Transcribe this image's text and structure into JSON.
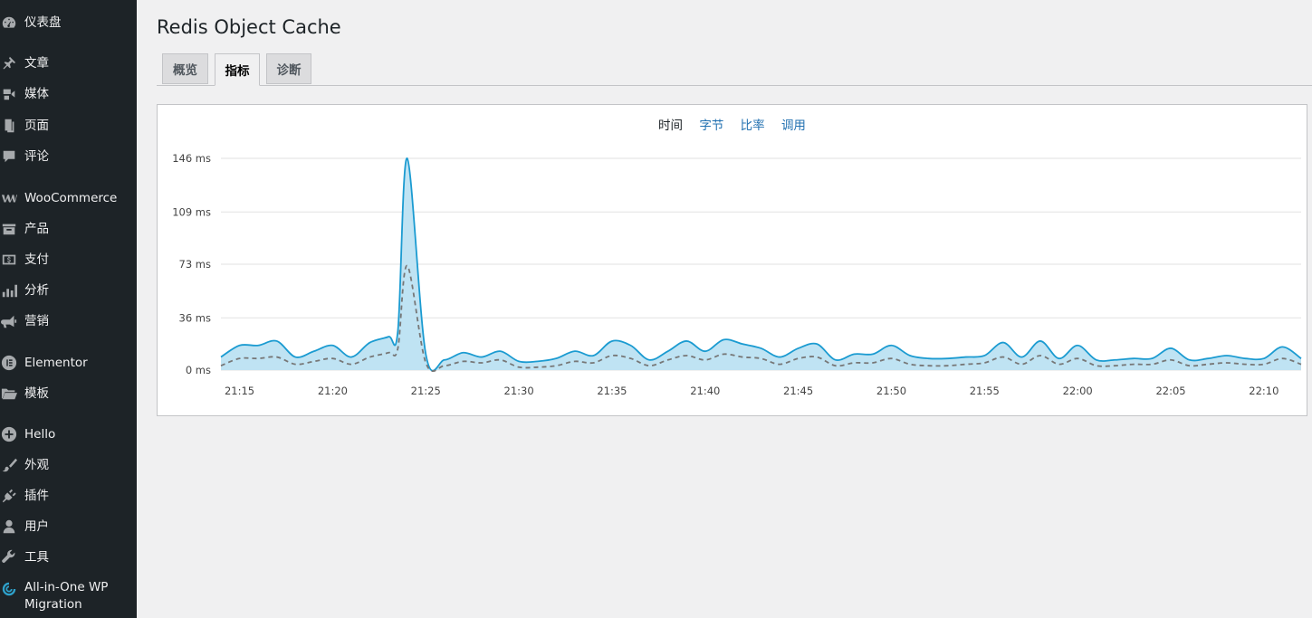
{
  "sidebar": {
    "items": [
      {
        "label": "仪表盘",
        "icon": "dashboard-icon"
      },
      {
        "label": "文章",
        "icon": "pushpin-icon"
      },
      {
        "label": "媒体",
        "icon": "media-icon"
      },
      {
        "label": "页面",
        "icon": "pages-icon"
      },
      {
        "label": "评论",
        "icon": "comment-icon"
      },
      {
        "label": "WooCommerce",
        "icon": "woocommerce-icon"
      },
      {
        "label": "产品",
        "icon": "archive-icon"
      },
      {
        "label": "支付",
        "icon": "money-icon"
      },
      {
        "label": "分析",
        "icon": "bar-chart-icon"
      },
      {
        "label": "营销",
        "icon": "megaphone-icon"
      },
      {
        "label": "Elementor",
        "icon": "elementor-icon"
      },
      {
        "label": "模板",
        "icon": "folder-open-icon"
      },
      {
        "label": "Hello",
        "icon": "plus-circle-icon"
      },
      {
        "label": "外观",
        "icon": "brush-icon"
      },
      {
        "label": "插件",
        "icon": "plug-icon"
      },
      {
        "label": "用户",
        "icon": "user-icon"
      },
      {
        "label": "工具",
        "icon": "wrench-icon"
      },
      {
        "label": "All-in-One WP Migration",
        "icon": "migration-icon"
      }
    ]
  },
  "page": {
    "title": "Redis Object Cache"
  },
  "tabs": [
    {
      "label": "概览"
    },
    {
      "label": "指标"
    },
    {
      "label": "诊断"
    }
  ],
  "chart_switch": [
    {
      "label": "时间"
    },
    {
      "label": "字节"
    },
    {
      "label": "比率"
    },
    {
      "label": "调用"
    }
  ],
  "colors": {
    "sidebar_bg": "#1d2327",
    "accent": "#2271b1",
    "series_line": "#1b9bd1",
    "series_fill": "#bfe3f3",
    "dashed_line": "#777777"
  },
  "chart_data": {
    "type": "area",
    "ylabel": "",
    "xlabel": "",
    "y_unit": "ms",
    "yticks": [
      "0 ms",
      "36 ms",
      "73 ms",
      "109 ms",
      "146 ms"
    ],
    "ytick_values": [
      0,
      36,
      73,
      109,
      146
    ],
    "ylim": [
      0,
      146
    ],
    "xticks": [
      "21:15",
      "21:20",
      "21:25",
      "21:30",
      "21:35",
      "21:40",
      "21:45",
      "21:50",
      "21:55",
      "22:00",
      "22:05",
      "22:10"
    ],
    "x_minutes_range": [
      "21:14",
      "22:12"
    ],
    "grid": true,
    "series": [
      {
        "style": "solid-area",
        "x": [
          "21:14",
          "21:15",
          "21:16",
          "21:17",
          "21:18",
          "21:19",
          "21:20",
          "21:21",
          "21:22",
          "21:23",
          "21:23:30",
          "21:24",
          "21:25",
          "21:26",
          "21:27",
          "21:28",
          "21:29",
          "21:30",
          "21:31",
          "21:32",
          "21:33",
          "21:34",
          "21:35",
          "21:36",
          "21:37",
          "21:38",
          "21:39",
          "21:40",
          "21:41",
          "21:42",
          "21:43",
          "21:44",
          "21:45",
          "21:46",
          "21:47",
          "21:48",
          "21:49",
          "21:50",
          "21:51",
          "21:52",
          "21:53",
          "21:54",
          "21:55",
          "21:56",
          "21:57",
          "21:58",
          "21:59",
          "22:00",
          "22:01",
          "22:02",
          "22:03",
          "22:04",
          "22:05",
          "22:06",
          "22:07",
          "22:08",
          "22:09",
          "22:10",
          "22:11",
          "22:12"
        ],
        "values": [
          9,
          17,
          17,
          20,
          9,
          13,
          17,
          9,
          19,
          23,
          27,
          146,
          11,
          7,
          12,
          9,
          13,
          6,
          6,
          8,
          13,
          10,
          20,
          17,
          7,
          13,
          20,
          13,
          21,
          18,
          15,
          9,
          15,
          18,
          7,
          11,
          11,
          17,
          10,
          8,
          8,
          9,
          10,
          19,
          9,
          20,
          8,
          17,
          7,
          7,
          8,
          8,
          15,
          7,
          8,
          10,
          8,
          8,
          16,
          8
        ],
        "name": ""
      },
      {
        "style": "dashed",
        "x": [
          "21:14",
          "21:15",
          "21:16",
          "21:17",
          "21:18",
          "21:19",
          "21:20",
          "21:21",
          "21:22",
          "21:23",
          "21:23:30",
          "21:24",
          "21:25",
          "21:26",
          "21:27",
          "21:28",
          "21:29",
          "21:30",
          "21:31",
          "21:32",
          "21:33",
          "21:34",
          "21:35",
          "21:36",
          "21:37",
          "21:38",
          "21:39",
          "21:40",
          "21:41",
          "21:42",
          "21:43",
          "21:44",
          "21:45",
          "21:46",
          "21:47",
          "21:48",
          "21:49",
          "21:50",
          "21:51",
          "21:52",
          "21:53",
          "21:54",
          "21:55",
          "21:56",
          "21:57",
          "21:58",
          "21:59",
          "22:00",
          "22:01",
          "22:02",
          "22:03",
          "22:04",
          "22:05",
          "22:06",
          "22:07",
          "22:08",
          "22:09",
          "22:10",
          "22:11",
          "22:12"
        ],
        "values": [
          3,
          8,
          8,
          9,
          4,
          6,
          8,
          4,
          9,
          12,
          15,
          72,
          5,
          3,
          6,
          5,
          7,
          2,
          2,
          3,
          6,
          5,
          10,
          8,
          3,
          7,
          10,
          7,
          11,
          9,
          8,
          4,
          8,
          9,
          3,
          5,
          5,
          8,
          4,
          3,
          3,
          4,
          5,
          9,
          4,
          10,
          4,
          8,
          3,
          3,
          4,
          4,
          7,
          3,
          4,
          5,
          4,
          4,
          8,
          4
        ],
        "name": ""
      }
    ]
  }
}
